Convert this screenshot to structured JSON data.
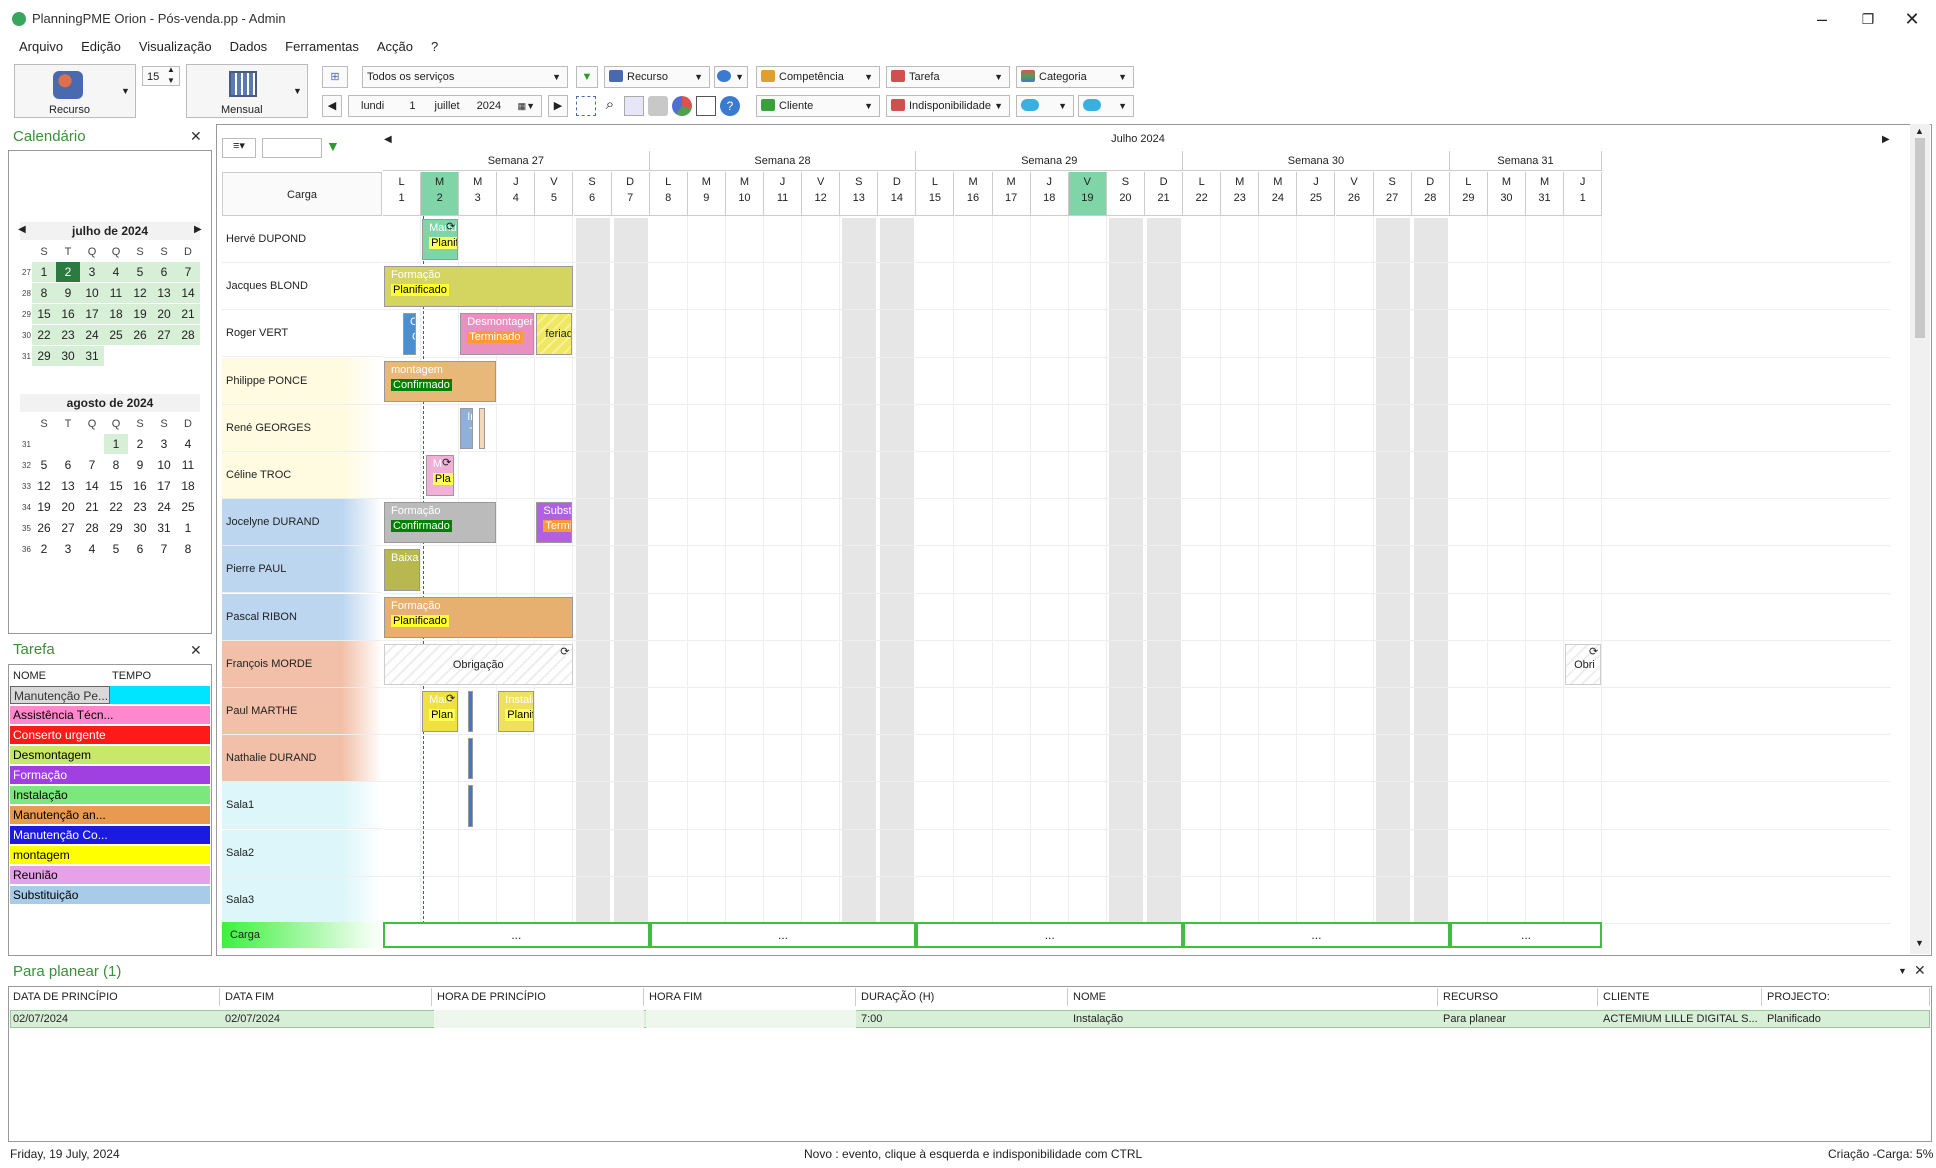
{
  "window": {
    "title": "PlanningPME Orion - Pós-venda.pp - Admin"
  },
  "menu": [
    "Arquivo",
    "Edição",
    "Visualização",
    "Dados",
    "Ferramentas",
    "Acção",
    "?"
  ],
  "toolbar": {
    "view_recurso": "Recurso",
    "spin_value": "15",
    "view_mensual": "Mensual",
    "services_filter": "Todos os serviços",
    "recurso_filter": "Recurso",
    "competencia": "Competência",
    "tarefa": "Tarefa",
    "categoria": "Categoria",
    "cliente": "Cliente",
    "indisponibilidade": "Indisponibilidade",
    "date": {
      "weekday": "lundi",
      "day": "1",
      "month": "juillet",
      "year": "2024"
    }
  },
  "calendar_panel": {
    "title": "Calendário",
    "weekday_heads": [
      "S",
      "T",
      "Q",
      "Q",
      "S",
      "S",
      "D"
    ],
    "months": [
      {
        "name": "julho de 2024",
        "weeks": [
          {
            "wk": "27",
            "days": [
              "1",
              "2",
              "3",
              "4",
              "5",
              "6",
              "7"
            ]
          },
          {
            "wk": "28",
            "days": [
              "8",
              "9",
              "10",
              "11",
              "12",
              "13",
              "14"
            ]
          },
          {
            "wk": "29",
            "days": [
              "15",
              "16",
              "17",
              "18",
              "19",
              "20",
              "21"
            ]
          },
          {
            "wk": "30",
            "days": [
              "22",
              "23",
              "24",
              "25",
              "26",
              "27",
              "28"
            ]
          },
          {
            "wk": "31",
            "days": [
              "29",
              "30",
              "31",
              "",
              "",
              "",
              ""
            ]
          }
        ]
      },
      {
        "name": "agosto de 2024",
        "weeks": [
          {
            "wk": "31",
            "days": [
              "",
              "",
              "",
              "1",
              "2",
              "3",
              "4"
            ]
          },
          {
            "wk": "32",
            "days": [
              "5",
              "6",
              "7",
              "8",
              "9",
              "10",
              "11"
            ]
          },
          {
            "wk": "33",
            "days": [
              "12",
              "13",
              "14",
              "15",
              "16",
              "17",
              "18"
            ]
          },
          {
            "wk": "34",
            "days": [
              "19",
              "20",
              "21",
              "22",
              "23",
              "24",
              "25"
            ]
          },
          {
            "wk": "35",
            "days": [
              "26",
              "27",
              "28",
              "29",
              "30",
              "31",
              "1"
            ]
          },
          {
            "wk": "36",
            "days": [
              "2",
              "3",
              "4",
              "5",
              "6",
              "7",
              "8"
            ]
          }
        ]
      }
    ]
  },
  "task_panel": {
    "title": "Tarefa",
    "col_name": "NOME",
    "col_time": "TEMPO",
    "items": [
      {
        "label": "Manutenção Pe...",
        "color": "#d9d9d9",
        "text_color": "#333333"
      },
      {
        "label": "Assistência Técn...",
        "color": "#ff88cc",
        "text_color": "#000000"
      },
      {
        "label": "Conserto urgente",
        "color": "#ff1a1a",
        "text_color": "#ffffff"
      },
      {
        "label": "Desmontagem",
        "color": "#c8e86a",
        "text_color": "#000000"
      },
      {
        "label": "Formação",
        "color": "#a040e0",
        "text_color": "#ffffff"
      },
      {
        "label": "Instalação",
        "color": "#7ce87c",
        "text_color": "#000000"
      },
      {
        "label": "Manutenção an...",
        "color": "#e89a50",
        "text_color": "#000000"
      },
      {
        "label": "Manutenção Co...",
        "color": "#1a1ae0",
        "text_color": "#ffffff"
      },
      {
        "label": "montagem",
        "color": "#ffff00",
        "text_color": "#000000"
      },
      {
        "label": "Reunião",
        "color": "#e8a0e8",
        "text_color": "#000000"
      },
      {
        "label": "Substituição",
        "color": "#a8cce8",
        "text_color": "#000000"
      }
    ]
  },
  "planner": {
    "month_label": "Julho 2024",
    "carga_label": "Carga",
    "weeks": [
      "Semana 27",
      "Semana 28",
      "Semana 29",
      "Semana 30",
      "Semana 31"
    ],
    "days": [
      {
        "l": "L",
        "n": "1"
      },
      {
        "l": "M",
        "n": "2"
      },
      {
        "l": "M",
        "n": "3"
      },
      {
        "l": "J",
        "n": "4"
      },
      {
        "l": "V",
        "n": "5"
      },
      {
        "l": "S",
        "n": "6"
      },
      {
        "l": "D",
        "n": "7"
      },
      {
        "l": "L",
        "n": "8"
      },
      {
        "l": "M",
        "n": "9"
      },
      {
        "l": "M",
        "n": "10"
      },
      {
        "l": "J",
        "n": "11"
      },
      {
        "l": "V",
        "n": "12"
      },
      {
        "l": "S",
        "n": "13"
      },
      {
        "l": "D",
        "n": "14"
      },
      {
        "l": "L",
        "n": "15"
      },
      {
        "l": "M",
        "n": "16"
      },
      {
        "l": "M",
        "n": "17"
      },
      {
        "l": "J",
        "n": "18"
      },
      {
        "l": "V",
        "n": "19"
      },
      {
        "l": "S",
        "n": "20"
      },
      {
        "l": "D",
        "n": "21"
      },
      {
        "l": "L",
        "n": "22"
      },
      {
        "l": "M",
        "n": "23"
      },
      {
        "l": "M",
        "n": "24"
      },
      {
        "l": "J",
        "n": "25"
      },
      {
        "l": "V",
        "n": "26"
      },
      {
        "l": "S",
        "n": "27"
      },
      {
        "l": "D",
        "n": "28"
      },
      {
        "l": "L",
        "n": "29"
      },
      {
        "l": "M",
        "n": "30"
      },
      {
        "l": "M",
        "n": "31"
      },
      {
        "l": "J",
        "n": "1"
      }
    ],
    "resources": [
      {
        "name": "Hervé DUPOND",
        "color": "#ffffff"
      },
      {
        "name": "Jacques BLOND",
        "color": "#ffffff"
      },
      {
        "name": "Roger VERT",
        "color": "#ffffff"
      },
      {
        "name": "Philippe PONCE",
        "color": "#fffbe0"
      },
      {
        "name": "René GEORGES",
        "color": "#fffbe0"
      },
      {
        "name": "Céline TROC",
        "color": "#fffbe0"
      },
      {
        "name": "Jocelyne DURAND",
        "color": "#bcd6f0"
      },
      {
        "name": "Pierre PAUL",
        "color": "#bcd6f0"
      },
      {
        "name": "Pascal RIBON",
        "color": "#bcd6f0"
      },
      {
        "name": "François MORDE",
        "color": "#f2c0a8"
      },
      {
        "name": "Paul MARTHE",
        "color": "#f2c0a8"
      },
      {
        "name": "Nathalie DURAND",
        "color": "#f2c0a8"
      },
      {
        "name": "Sala1",
        "color": "#dcf6fa"
      },
      {
        "name": "Sala2",
        "color": "#dcf6fa"
      },
      {
        "name": "Sala3",
        "color": "#dcf6fa"
      }
    ],
    "bars": [
      {
        "title": "Manu",
        "status": "Planif",
        "bg": "#7fd5a8",
        "sc": "#ffff55",
        "stc": "#000",
        "sync": true
      },
      {
        "title": "Formação",
        "status": "Planificado",
        "bg": "#d4d460",
        "sc": "#ffff33",
        "stc": "#000"
      },
      {
        "title": "C",
        "status": "C",
        "bg": "#4a90d0"
      },
      {
        "title": "Desmontagem",
        "status": "Terminado",
        "bg": "#e890c0",
        "sc": "#ff9933",
        "stc": "#fff"
      },
      {
        "title": "feriado",
        "status": "",
        "bg": "#f0e860"
      },
      {
        "title": "montagem",
        "status": "Confirmado",
        "bg": "#e8b878",
        "sc": "#008000",
        "stc": "#fff"
      },
      {
        "title": "In",
        "status": "T",
        "bg": "#8fb0d8"
      },
      {
        "title": "",
        "status": "",
        "bg": "#f5d8b8"
      },
      {
        "title": "M",
        "status": "Pla",
        "bg": "#f0b0d8",
        "sc": "#ffff55",
        "stc": "#000",
        "sync": true
      },
      {
        "title": "Formação",
        "status": "Confirmado",
        "bg": "#bbbbbb",
        "sc": "#008000",
        "stc": "#fff"
      },
      {
        "title": "Substit",
        "status": "Termina",
        "bg": "#b060e0",
        "sc": "#ff9933",
        "stc": "#fff"
      },
      {
        "title": "Baixa p",
        "status": "",
        "bg": "#b8b850"
      },
      {
        "title": "Formação",
        "status": "Planificado",
        "bg": "#e8b070",
        "sc": "#ffff33",
        "stc": "#000"
      },
      {
        "title": "Obrigação",
        "status": "",
        "bg": "#ffffff",
        "sync": true
      },
      {
        "title": "Obri",
        "status": "",
        "bg": "#ffffff",
        "sync": true
      },
      {
        "title": "Man",
        "status": "Plan",
        "bg": "#f0e040",
        "sc": "#ffff55",
        "stc": "#000",
        "sync": true
      },
      {
        "title": "",
        "status": "",
        "bg": "#4a70d0"
      },
      {
        "title": "Instala",
        "status": "Planific",
        "bg": "#f0e060",
        "sc": "#ffff55",
        "stc": "#000"
      },
      {
        "title": "",
        "status": "",
        "bg": "#4a70d0"
      },
      {
        "title": "",
        "status": "",
        "bg": "#4a70d0"
      }
    ],
    "carga_cells": [
      "...",
      "...",
      "...",
      "...",
      "..."
    ]
  },
  "to_plan": {
    "title": "Para planear (1)",
    "columns": [
      "DATA DE PRINCÍPIO",
      "DATA FIM",
      "HORA DE PRINCÍPIO",
      "HORA FIM",
      "DURAÇÃO (H)",
      "NOME",
      "RECURSO",
      "CLIENTE",
      "PROJECTO:"
    ],
    "rows": [
      [
        "02/07/2024",
        "02/07/2024",
        "",
        "",
        "7:00",
        "Instalação",
        "Para planear",
        "ACTEMIUM LILLE DIGITAL S...",
        "Planificado"
      ]
    ]
  },
  "status_bar": {
    "date": "Friday, 19 July, 2024",
    "hint": "Novo : evento, clique à esquerda e indisponibilidade com CTRL",
    "load": "Criação -Carga: 5%"
  }
}
